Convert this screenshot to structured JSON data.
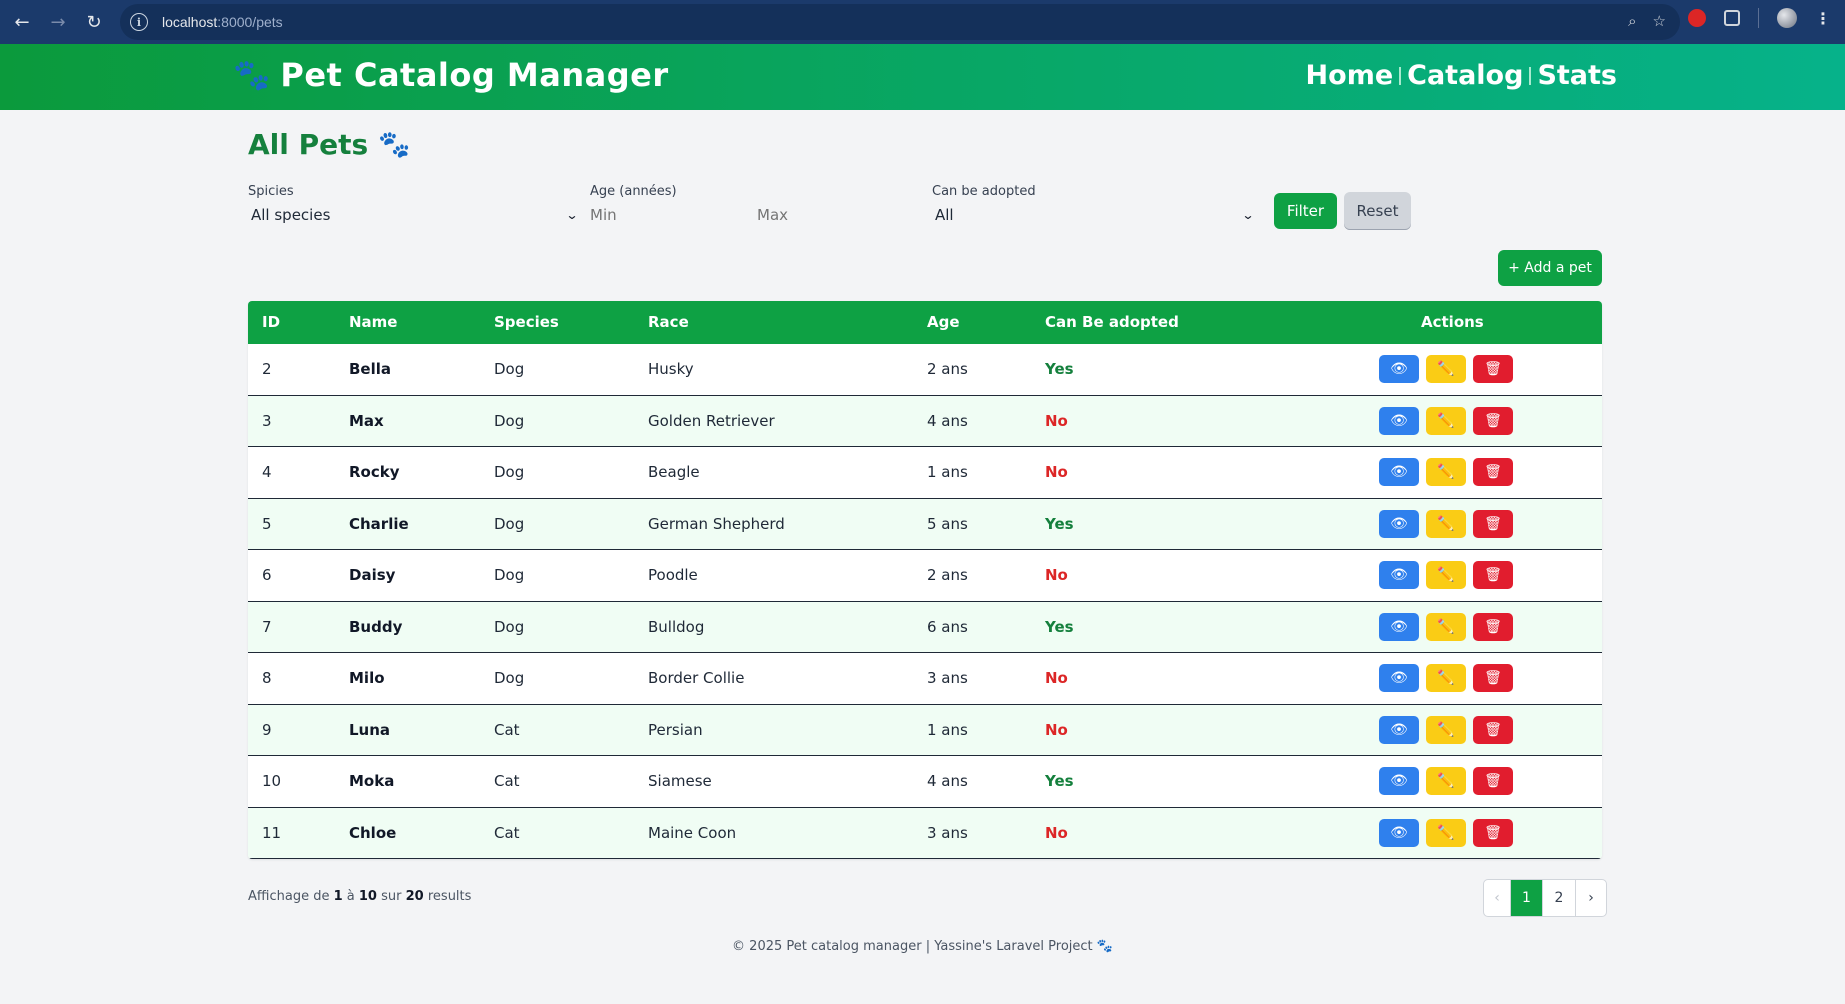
{
  "browser": {
    "url_host": "localhost",
    "url_path": ":8000/pets"
  },
  "app": {
    "brand_icon": "🐾",
    "title": "Pet Catalog Manager",
    "nav": [
      "Home",
      "Catalog",
      "Stats"
    ]
  },
  "page": {
    "title": "All Pets",
    "title_icon": "🐾"
  },
  "filters": {
    "species_label": "Spicies",
    "species_value": "All species",
    "age_label": "Age (années)",
    "age_min_placeholder": "Min",
    "age_max_placeholder": "Max",
    "adopt_label": "Can be adopted",
    "adopt_value": "All",
    "filter_button": "Filter",
    "reset_button": "Reset"
  },
  "add_button": "+ Add a pet",
  "table": {
    "headers": [
      "ID",
      "Name",
      "Species",
      "Race",
      "Age",
      "Can Be adopted",
      "Actions"
    ],
    "rows": [
      {
        "id": "2",
        "name": "Bella",
        "species": "Dog",
        "race": "Husky",
        "age": "2 ans",
        "adopt": "Yes"
      },
      {
        "id": "3",
        "name": "Max",
        "species": "Dog",
        "race": "Golden Retriever",
        "age": "4 ans",
        "adopt": "No"
      },
      {
        "id": "4",
        "name": "Rocky",
        "species": "Dog",
        "race": "Beagle",
        "age": "1 ans",
        "adopt": "No"
      },
      {
        "id": "5",
        "name": "Charlie",
        "species": "Dog",
        "race": "German Shepherd",
        "age": "5 ans",
        "adopt": "Yes"
      },
      {
        "id": "6",
        "name": "Daisy",
        "species": "Dog",
        "race": "Poodle",
        "age": "2 ans",
        "adopt": "No"
      },
      {
        "id": "7",
        "name": "Buddy",
        "species": "Dog",
        "race": "Bulldog",
        "age": "6 ans",
        "adopt": "Yes"
      },
      {
        "id": "8",
        "name": "Milo",
        "species": "Dog",
        "race": "Border Collie",
        "age": "3 ans",
        "adopt": "No"
      },
      {
        "id": "9",
        "name": "Luna",
        "species": "Cat",
        "race": "Persian",
        "age": "1 ans",
        "adopt": "No"
      },
      {
        "id": "10",
        "name": "Moka",
        "species": "Cat",
        "race": "Siamese",
        "age": "4 ans",
        "adopt": "Yes"
      },
      {
        "id": "11",
        "name": "Chloe",
        "species": "Cat",
        "race": "Maine Coon",
        "age": "3 ans",
        "adopt": "No"
      }
    ],
    "action_icons": {
      "view": "👁",
      "edit": "✏️",
      "delete": "🗑"
    }
  },
  "summary": {
    "prefix": "Affichage de",
    "from": "1",
    "mid1": "à",
    "to": "10",
    "mid2": "sur",
    "total": "20",
    "suffix": "results"
  },
  "pagination": {
    "prev": "‹",
    "pages": [
      "1",
      "2"
    ],
    "next": "›",
    "active": "1"
  },
  "footer": "© 2025 Pet catalog manager | Yassine's Laravel Project 🐾",
  "colors": {
    "primary_green": "#0ea144",
    "title_green": "#15803d",
    "yes": "#15803d",
    "no": "#dc2626",
    "view_btn": "#2f80ed",
    "edit_btn": "#facc15",
    "delete_btn": "#e11d2e"
  }
}
